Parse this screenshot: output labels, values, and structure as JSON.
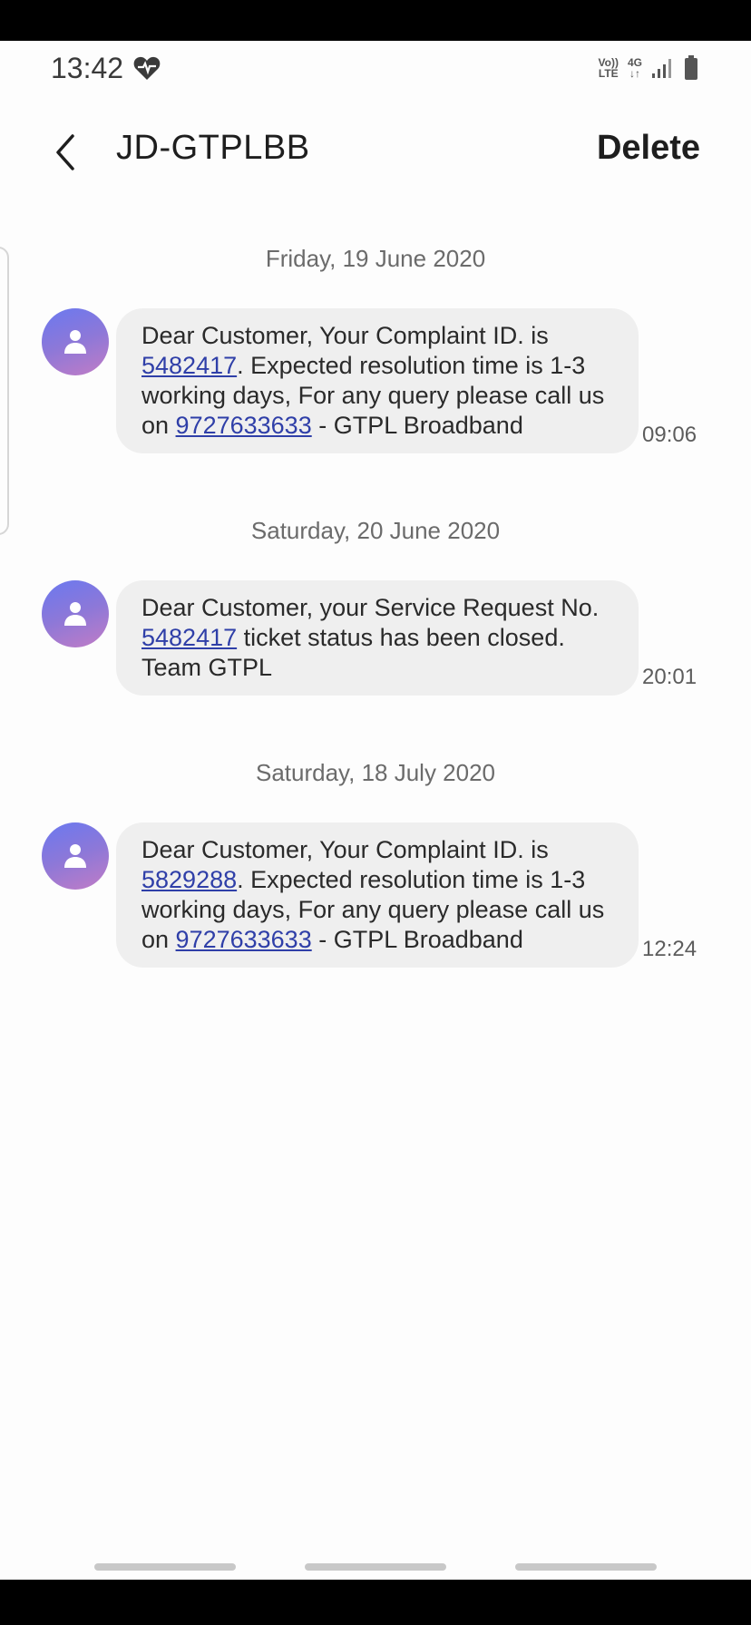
{
  "status_bar": {
    "time": "13:42",
    "volte_top": "Vo))",
    "volte_bottom": "LTE",
    "network_top": "4G",
    "network_bottom": "↓↑"
  },
  "header": {
    "title": "JD-GTPLBB",
    "delete_label": "Delete"
  },
  "conversation": [
    {
      "date": "Friday, 19 June 2020",
      "time": "09:06",
      "parts": [
        {
          "text": "Dear Customer, Your Complaint ID. is "
        },
        {
          "text": "5482417",
          "link": true
        },
        {
          "text": ". Expected resolution time is 1-3 working days, For any query please call us on "
        },
        {
          "text": "9727633633",
          "link": true
        },
        {
          "text": " - GTPL Broadband"
        }
      ]
    },
    {
      "date": "Saturday, 20 June 2020",
      "time": "20:01",
      "parts": [
        {
          "text": "Dear Customer, your Service Request No. "
        },
        {
          "text": "5482417",
          "link": true
        },
        {
          "text": " ticket status has been closed. Team GTPL"
        }
      ]
    },
    {
      "date": "Saturday, 18 July 2020",
      "time": "12:24",
      "parts": [
        {
          "text": "Dear Customer, Your Complaint ID. is "
        },
        {
          "text": "5829288",
          "link": true
        },
        {
          "text": ". Expected resolution time is 1-3 working days, For any query please call us on "
        },
        {
          "text": "9727633633",
          "link": true
        },
        {
          "text": " - GTPL Broadband"
        }
      ]
    }
  ],
  "colors": {
    "link": "#2f3fa8",
    "bubble": "#efefef",
    "avatar_start": "#6a79f0",
    "avatar_end": "#c17cc6"
  }
}
